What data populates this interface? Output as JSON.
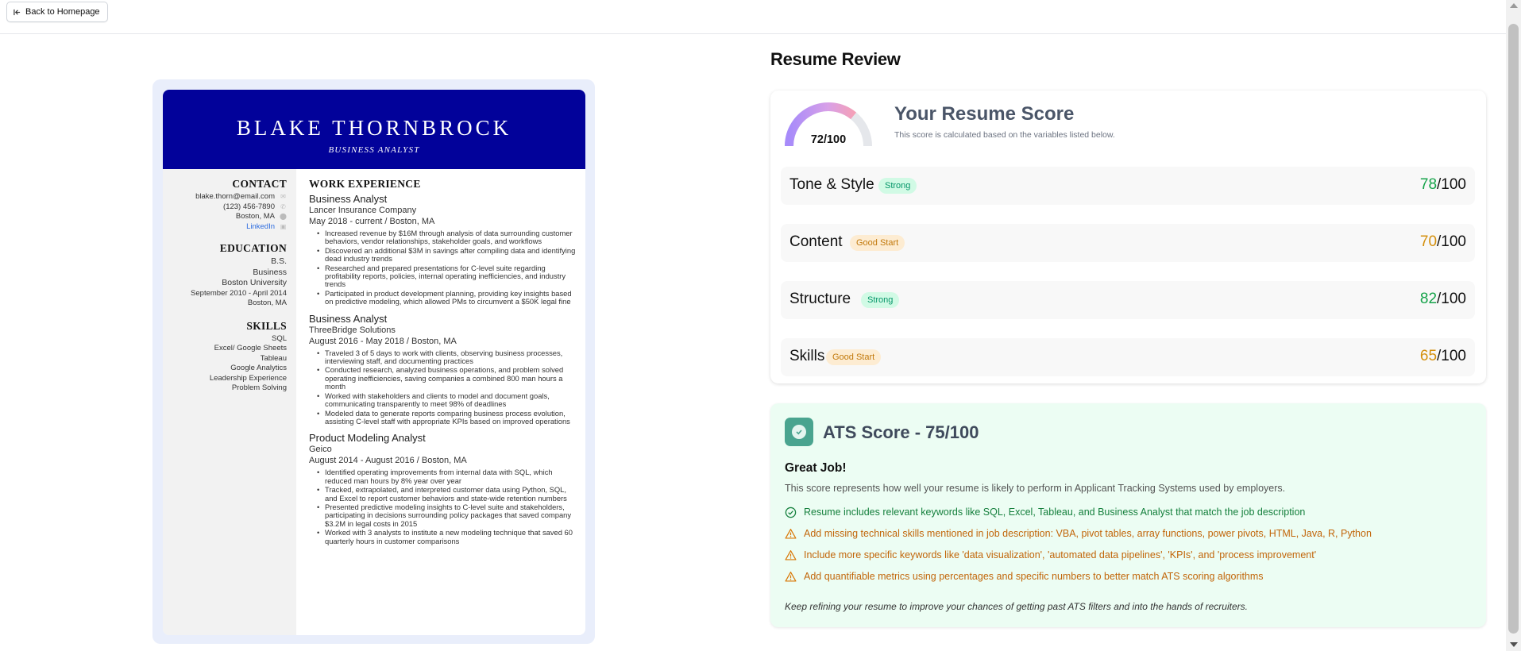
{
  "nav": {
    "back_label": "Back to Homepage"
  },
  "resume": {
    "name": "BLAKE THORNBROCK",
    "title": "BUSINESS ANALYST",
    "contact": {
      "heading": "CONTACT",
      "email": "blake.thorn@email.com",
      "phone": "(123) 456-7890",
      "location": "Boston, MA",
      "linkedin": "LinkedIn"
    },
    "education": {
      "heading": "EDUCATION",
      "degree": "B.S.",
      "field": "Business",
      "school": "Boston University",
      "dates": "September 2010 - April 2014",
      "location": "Boston, MA"
    },
    "skills": {
      "heading": "SKILLS",
      "items": [
        "SQL",
        "Excel/ Google Sheets",
        "Tableau",
        "Google Analytics",
        "Leadership Experience",
        "Problem Solving"
      ]
    },
    "experience": {
      "heading": "WORK EXPERIENCE",
      "jobs": [
        {
          "title": "Business Analyst",
          "company": "Lancer Insurance Company",
          "dates": "May 2018 - current  /  Boston, MA",
          "bullets": [
            "Increased revenue by $16M through analysis of data surrounding customer behaviors, vendor relationships, stakeholder goals, and workflows",
            "Discovered an additional $3M in savings after compiling data and identifying dead industry trends",
            "Researched and prepared presentations for C-level suite regarding profitability reports, policies, internal operating inefficiencies, and industry trends",
            "Participated in product development planning, providing key insights based on predictive modeling, which allowed PMs to circumvent a $50K legal fine"
          ]
        },
        {
          "title": "Business Analyst",
          "company": "ThreeBridge Solutions",
          "dates": "August 2016 - May 2018  /  Boston, MA",
          "bullets": [
            "Traveled 3 of 5 days to work with clients, observing business processes, interviewing staff, and documenting practices",
            "Conducted research, analyzed business operations, and problem solved operating inefficiencies, saving companies a combined 800 man hours a month",
            "Worked with stakeholders and clients to model and document goals, communicating transparently to meet 98% of deadlines",
            "Modeled data to generate reports comparing business process evolution, assisting C-level staff with appropriate KPIs based on improved operations"
          ]
        },
        {
          "title": "Product Modeling Analyst",
          "company": "Geico",
          "dates": "August 2014 - August 2016  /  Boston, MA",
          "bullets": [
            "Identified operating improvements from internal data with SQL, which reduced man hours by 8% year over year",
            "Tracked, extrapolated, and interpreted customer data using Python, SQL, and Excel to report customer behaviors and state-wide retention numbers",
            "Presented predictive modeling insights to C-level suite and stakeholders, participating in decisions surrounding policy packages that saved company $3.2M in legal costs in 2015",
            "Worked with 3 analysts to institute a new modeling technique that saved 60 quarterly hours in customer comparisons"
          ]
        }
      ]
    }
  },
  "review": {
    "heading": "Resume Review",
    "score_heading": "Your Resume Score",
    "score_sub": "This score is calculated based on the variables listed below.",
    "overall_text": "72/100",
    "overall_value": 72,
    "categories": [
      {
        "name": "Tone & Style",
        "badge": "Strong",
        "score": "78",
        "out_of": "/100",
        "level": "strong"
      },
      {
        "name": "Content",
        "badge": "Good Start",
        "score": "70",
        "out_of": "/100",
        "level": "good"
      },
      {
        "name": "Structure",
        "badge": "Strong",
        "score": "82",
        "out_of": "/100",
        "level": "strong"
      },
      {
        "name": "Skills",
        "badge": "Good Start",
        "score": "65",
        "out_of": "/100",
        "level": "good"
      }
    ]
  },
  "ats": {
    "title": "ATS Score - 75/100",
    "great": "Great Job!",
    "desc": "This score represents how well your resume is likely to perform in Applicant Tracking Systems used by employers.",
    "items": [
      {
        "type": "good",
        "text": "Resume includes relevant keywords like SQL, Excel, Tableau, and Business Analyst that match the job description"
      },
      {
        "type": "warn",
        "text": "Add missing technical skills mentioned in job description: VBA, pivot tables, array functions, power pivots, HTML, Java, R, Python"
      },
      {
        "type": "warn",
        "text": "Include more specific keywords like 'data visualization', 'automated data pipelines', 'KPIs', and 'process improvement'"
      },
      {
        "type": "warn",
        "text": "Add quantifiable metrics using percentages and specific numbers to better match ATS scoring algorithms"
      }
    ],
    "footer": "Keep refining your resume to improve your chances of getting past ATS filters and into the hands of recruiters."
  },
  "colors": {
    "resume_header": "#02029a",
    "strong_green": "#16a34a",
    "good_orange": "#d4900e",
    "ats_background": "#ecfdf3"
  }
}
